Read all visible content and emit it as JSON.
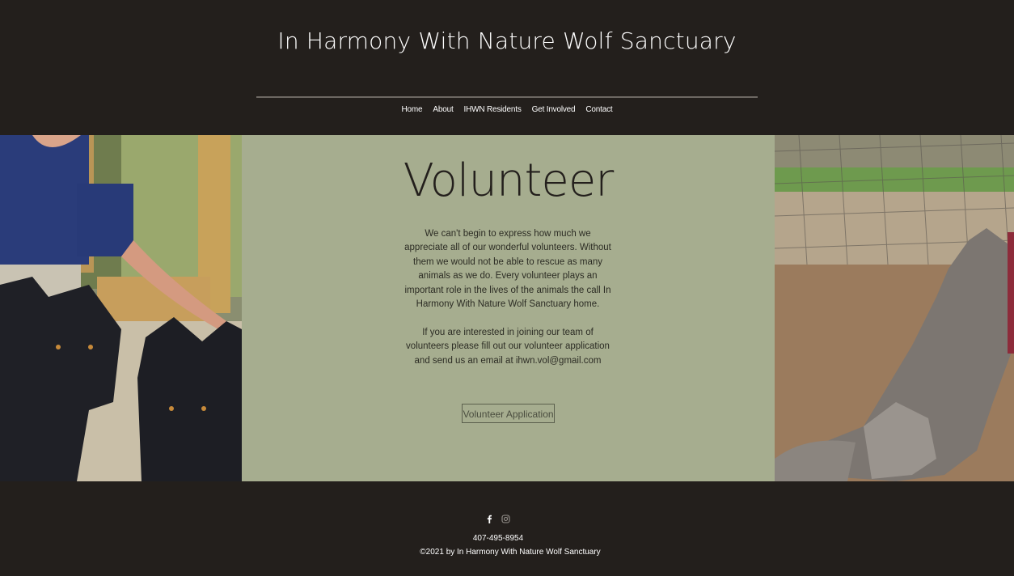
{
  "site": {
    "title": "In Harmony With Nature Wolf Sanctuary"
  },
  "nav": {
    "items": [
      {
        "label": "Home"
      },
      {
        "label": "About"
      },
      {
        "label": "IHWN Residents"
      },
      {
        "label": "Get Involved"
      },
      {
        "label": "Contact"
      }
    ]
  },
  "volunteer": {
    "title": "Volunteer",
    "paragraph1": "We can't begin to express how much we appreciate all of our wonderful volunteers. Without them we would not be able to rescue as many animals as we do.  Every volunteer plays an important role in the lives of the animals the call In Harmony With Nature Wolf Sanctuary home.",
    "paragraph2": "If you are interested in joining our team of volunteers please fill out our volunteer application and send us an email at ihwn.vol@gmail.com",
    "button_label": "Volunteer Application"
  },
  "photos": {
    "left_icon": "volunteer-with-black-wolves-photo",
    "right_icon": "gray-wolf-in-enclosure-photo"
  },
  "footer": {
    "social": [
      {
        "icon": "facebook-icon"
      },
      {
        "icon": "instagram-icon"
      }
    ],
    "phone": "407-495-8954",
    "copyright": "©2021 by In Harmony With Nature Wolf Sanctuary"
  },
  "colors": {
    "background": "#231f1c",
    "panel": "#a6ad8f",
    "text_light": "#ffffff",
    "text_dark": "#231f1c"
  }
}
